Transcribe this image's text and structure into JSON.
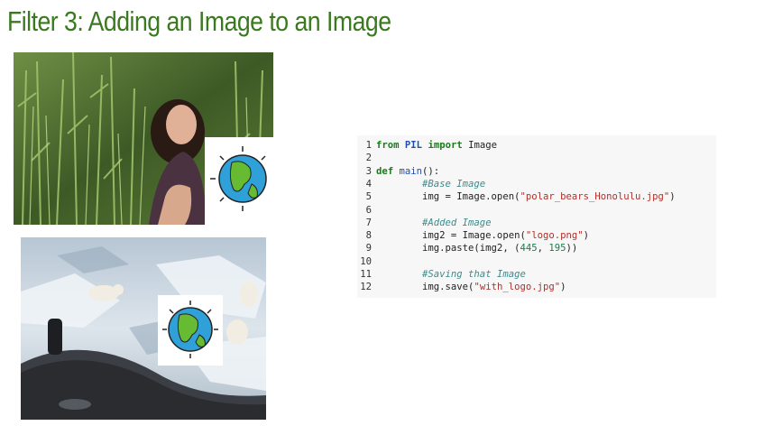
{
  "title": "Filter 3: Adding an Image to an Image",
  "colors": {
    "title": "#3a7a1f",
    "code_bg": "#f7f7f7"
  },
  "images": [
    {
      "name": "woman-in-plants-photo",
      "overlay_icon": "globe-icon"
    },
    {
      "name": "polar-bears-submarine-photo",
      "overlay_icon": "globe-icon"
    }
  ],
  "code": {
    "lines": [
      {
        "n": "1",
        "tokens": [
          {
            "t": "from",
            "c": "kw"
          },
          {
            "t": " "
          },
          {
            "t": "PIL",
            "c": "mod"
          },
          {
            "t": " "
          },
          {
            "t": "import",
            "c": "kw"
          },
          {
            "t": " Image"
          }
        ]
      },
      {
        "n": "2",
        "tokens": []
      },
      {
        "n": "3",
        "tokens": [
          {
            "t": "def",
            "c": "kw"
          },
          {
            "t": " "
          },
          {
            "t": "main",
            "c": "fn"
          },
          {
            "t": "():"
          }
        ]
      },
      {
        "n": "4",
        "tokens": [
          {
            "t": "        "
          },
          {
            "t": "#Base Image",
            "c": "cm"
          }
        ]
      },
      {
        "n": "5",
        "tokens": [
          {
            "t": "        img = Image.open("
          },
          {
            "t": "\"polar_bears_Honolulu.jpg\"",
            "c": "st"
          },
          {
            "t": ")"
          }
        ]
      },
      {
        "n": "6",
        "tokens": []
      },
      {
        "n": "7",
        "tokens": [
          {
            "t": "        "
          },
          {
            "t": "#Added Image",
            "c": "cm"
          }
        ]
      },
      {
        "n": "8",
        "tokens": [
          {
            "t": "        img2 = Image.open("
          },
          {
            "t": "\"logo.png\"",
            "c": "st"
          },
          {
            "t": ")"
          }
        ]
      },
      {
        "n": "9",
        "tokens": [
          {
            "t": "        img.paste(img2, ("
          },
          {
            "t": "445",
            "c": "nm"
          },
          {
            "t": ", "
          },
          {
            "t": "195",
            "c": "nm"
          },
          {
            "t": "))"
          }
        ]
      },
      {
        "n": "10",
        "tokens": []
      },
      {
        "n": "11",
        "tokens": [
          {
            "t": "        "
          },
          {
            "t": "#Saving that Image",
            "c": "cm"
          }
        ]
      },
      {
        "n": "12",
        "tokens": [
          {
            "t": "        img.save("
          },
          {
            "t": "\"with_logo.jpg\"",
            "c": "st"
          },
          {
            "t": ")"
          }
        ]
      }
    ]
  }
}
